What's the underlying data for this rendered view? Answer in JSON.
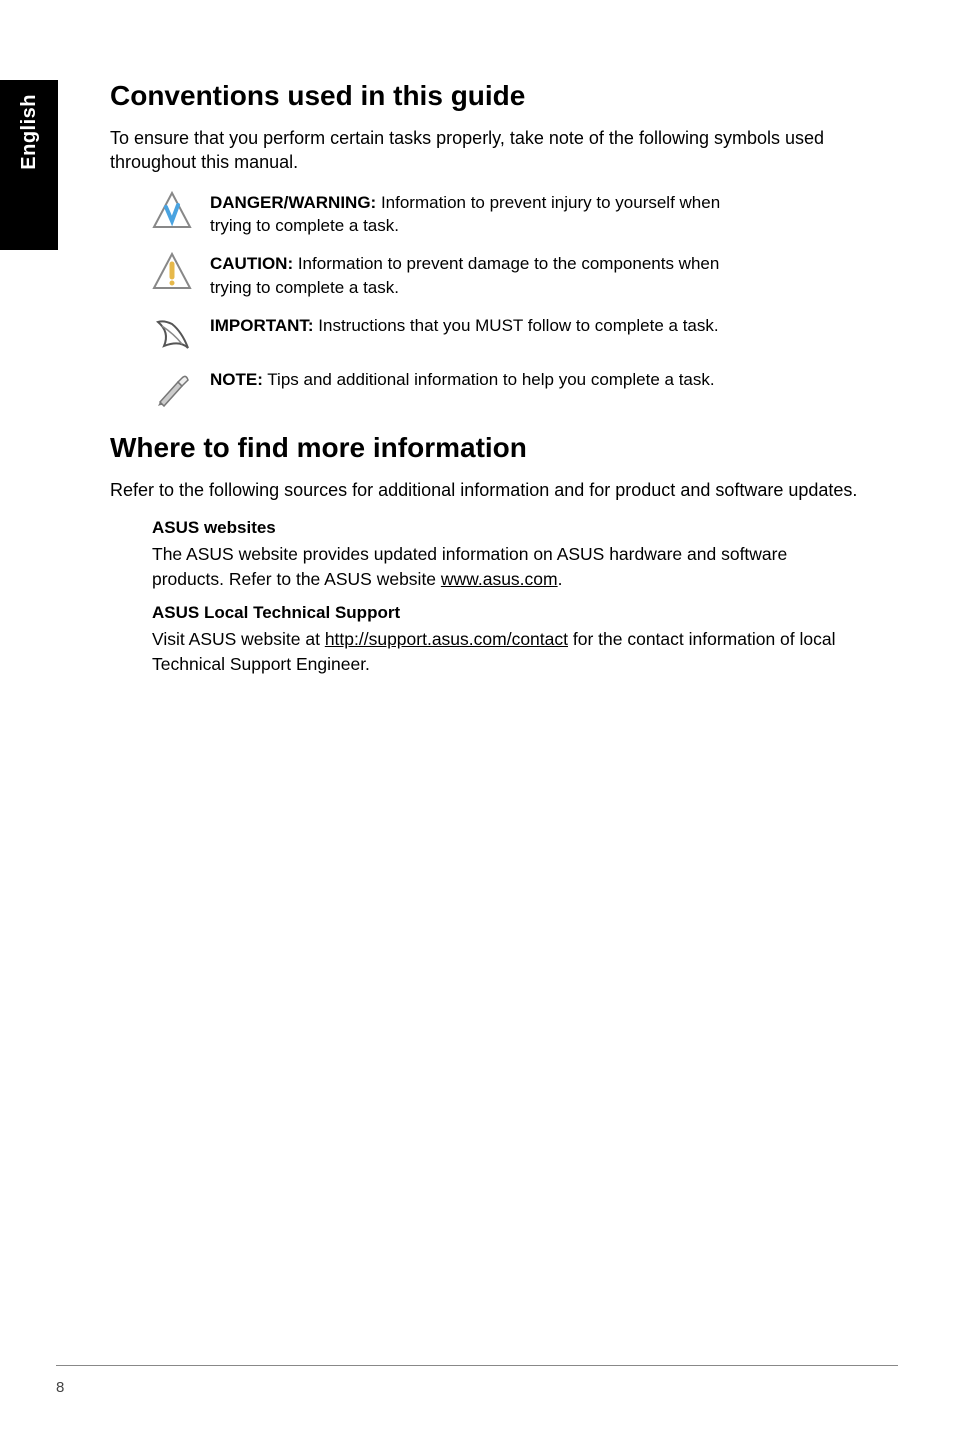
{
  "sideTab": {
    "label": "English"
  },
  "conventions": {
    "title": "Conventions used in this guide",
    "intro": "To ensure that you perform certain tasks properly, take note of the following symbols used throughout this manual.",
    "items": [
      {
        "labelPrefix": "DANGER/WARNING:",
        "text": " Information to prevent injury to yourself when trying to complete a task."
      },
      {
        "labelPrefix": "CAUTION:",
        "text": " Information to prevent damage to the components when trying to complete a task."
      },
      {
        "labelPrefix": "IMPORTANT:",
        "text": " Instructions that you MUST follow to complete a task."
      },
      {
        "labelPrefix": "NOTE:",
        "text": " Tips and additional information to help you complete a task."
      }
    ]
  },
  "where": {
    "title": "Where to find more information",
    "intro": "Refer to the following sources for additional information and for product and software updates.",
    "asusWebsites": {
      "heading": "ASUS websites",
      "preText": "The ASUS website provides updated information on ASUS hardware and software products. Refer to the ASUS website ",
      "link": "www.asus.com",
      "postText": "."
    },
    "localSupport": {
      "heading": "ASUS Local Technical Support",
      "preText": "Visit ASUS website at ",
      "link": "http://support.asus.com/contact",
      "postText": " for the contact information of local Technical Support Engineer."
    }
  },
  "pageNumber": "8"
}
